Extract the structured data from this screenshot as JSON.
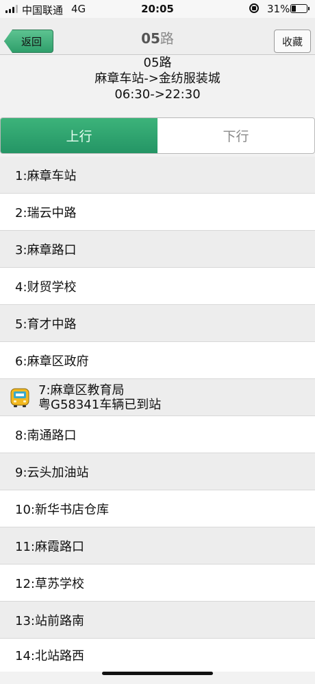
{
  "status_bar": {
    "carrier": "中国联通",
    "network": "4G",
    "time": "20:05",
    "battery": "31%",
    "battery_level": 0.31
  },
  "nav": {
    "back_label": "返回",
    "title_bold": "05",
    "title_rest": "路",
    "favorite_label": "收藏"
  },
  "route": {
    "name": "05路",
    "direction": "麻章车站->金纺服装城",
    "hours": "06:30->22:30"
  },
  "tabs": [
    {
      "label": "上行",
      "active": true
    },
    {
      "label": "下行",
      "active": false
    }
  ],
  "stops": [
    {
      "label": "1:麻章车站"
    },
    {
      "label": "2:瑞云中路"
    },
    {
      "label": "3:麻章路口"
    },
    {
      "label": "4:财贸学校"
    },
    {
      "label": "5:育才中路"
    },
    {
      "label": "6:麻章区政府"
    },
    {
      "label": "7:麻章区教育局",
      "status": "粤G58341车辆已到站",
      "bus_icon": "bus-icon"
    },
    {
      "label": "8:南通路口"
    },
    {
      "label": "9:云头加油站"
    },
    {
      "label": "10:新华书店仓库"
    },
    {
      "label": "11:麻霞路口"
    },
    {
      "label": "12:草苏学校"
    },
    {
      "label": "13:站前路南"
    },
    {
      "label": "14:北站路西"
    }
  ],
  "colors": {
    "accent": "#2fa56f",
    "bus_yellow": "#f2b820"
  }
}
